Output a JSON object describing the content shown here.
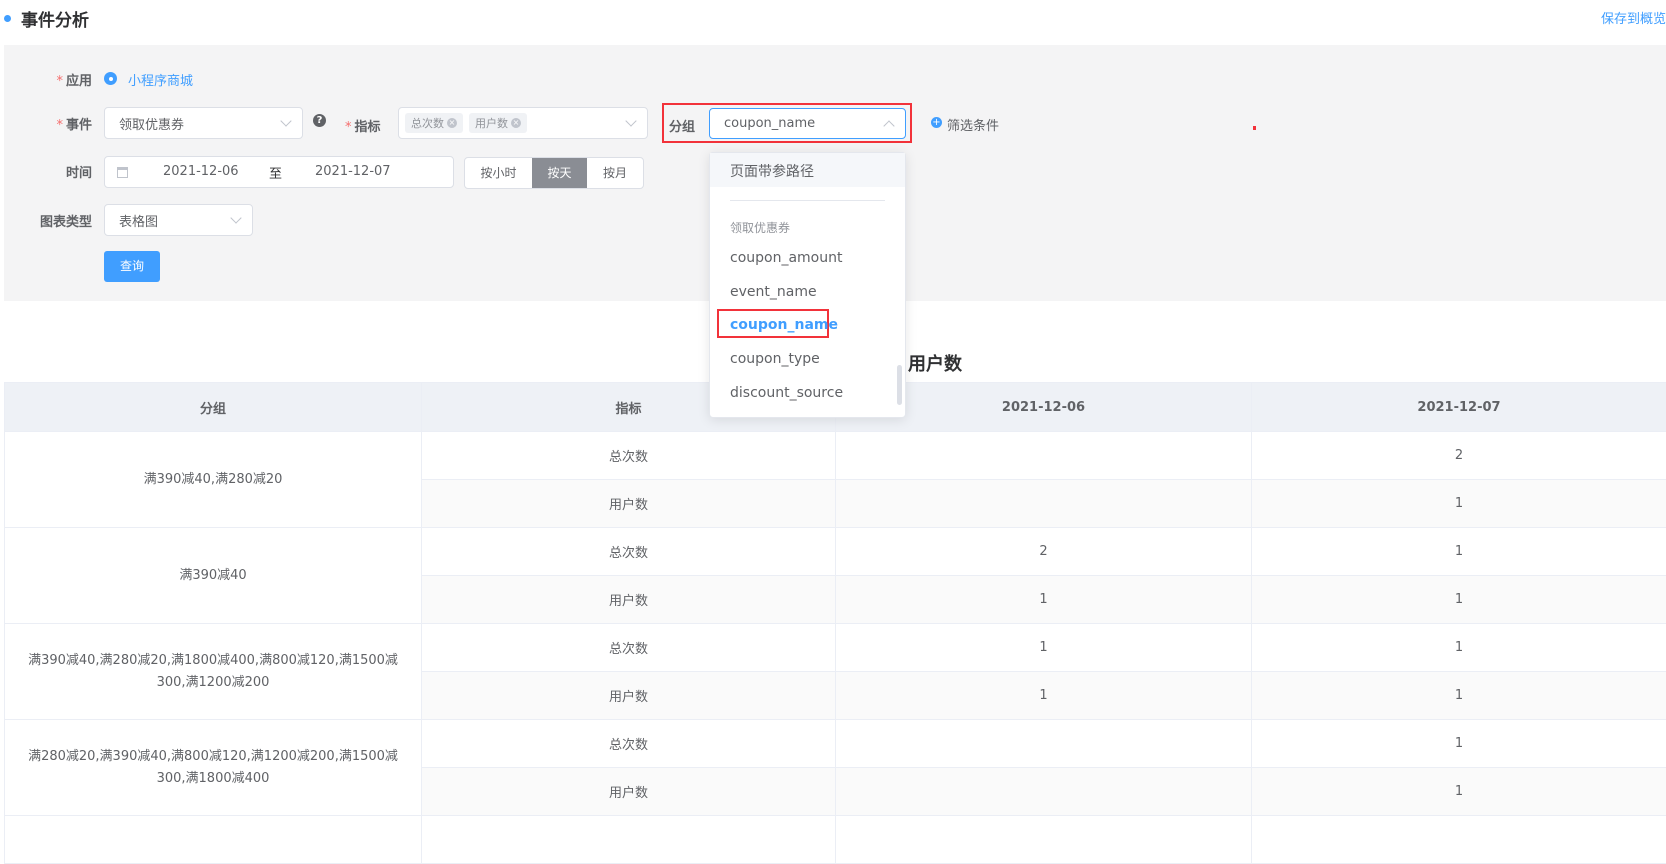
{
  "header": {
    "title": "事件分析",
    "save_link": "保存到概览"
  },
  "form": {
    "app": {
      "label": "应用",
      "value": "小程序商城"
    },
    "event": {
      "label": "事件",
      "value": "领取优惠券",
      "help_icon": "question-circle-icon"
    },
    "metric": {
      "label": "指标",
      "tags": [
        "总次数",
        "用户数"
      ]
    },
    "group": {
      "label": "分组",
      "value": "coupon_name"
    },
    "filter": {
      "label": "筛选条件"
    },
    "time": {
      "label": "时间",
      "start": "2021-12-06",
      "sep": "至",
      "end": "2021-12-07",
      "granularity": [
        "按小时",
        "按天",
        "按月"
      ],
      "selected": "按天"
    },
    "chart_type": {
      "label": "图表类型",
      "value": "表格图"
    },
    "query_button": "查询"
  },
  "group_dropdown": {
    "top_item": "页面带参路径",
    "section": "领取优惠券",
    "items": [
      "coupon_amount",
      "event_name",
      "coupon_name",
      "coupon_type",
      "discount_source"
    ],
    "selected": "coupon_name"
  },
  "table": {
    "title": "用户数",
    "columns": [
      "分组",
      "指标",
      "2021-12-06",
      "2021-12-07"
    ],
    "groups": [
      {
        "name": "满390减40,满280减20",
        "rows": [
          {
            "metric": "总次数",
            "d1": "",
            "d2": "2"
          },
          {
            "metric": "用户数",
            "d1": "",
            "d2": "1"
          }
        ]
      },
      {
        "name": "满390减40",
        "rows": [
          {
            "metric": "总次数",
            "d1": "2",
            "d2": "1"
          },
          {
            "metric": "用户数",
            "d1": "1",
            "d2": "1"
          }
        ]
      },
      {
        "name": "满390减40,满280减20,满1800减400,满800减120,满1500减300,满1200减200",
        "rows": [
          {
            "metric": "总次数",
            "d1": "1",
            "d2": "1"
          },
          {
            "metric": "用户数",
            "d1": "1",
            "d2": "1"
          }
        ]
      },
      {
        "name": "满280减20,满390减40,满800减120,满1200减200,满1500减300,满1800减400",
        "rows": [
          {
            "metric": "总次数",
            "d1": "",
            "d2": "1"
          },
          {
            "metric": "用户数",
            "d1": "",
            "d2": "1"
          }
        ]
      }
    ]
  },
  "colors": {
    "accent": "#409eff",
    "highlight": "#f2323a",
    "selected_btn": "#8a8d94"
  }
}
